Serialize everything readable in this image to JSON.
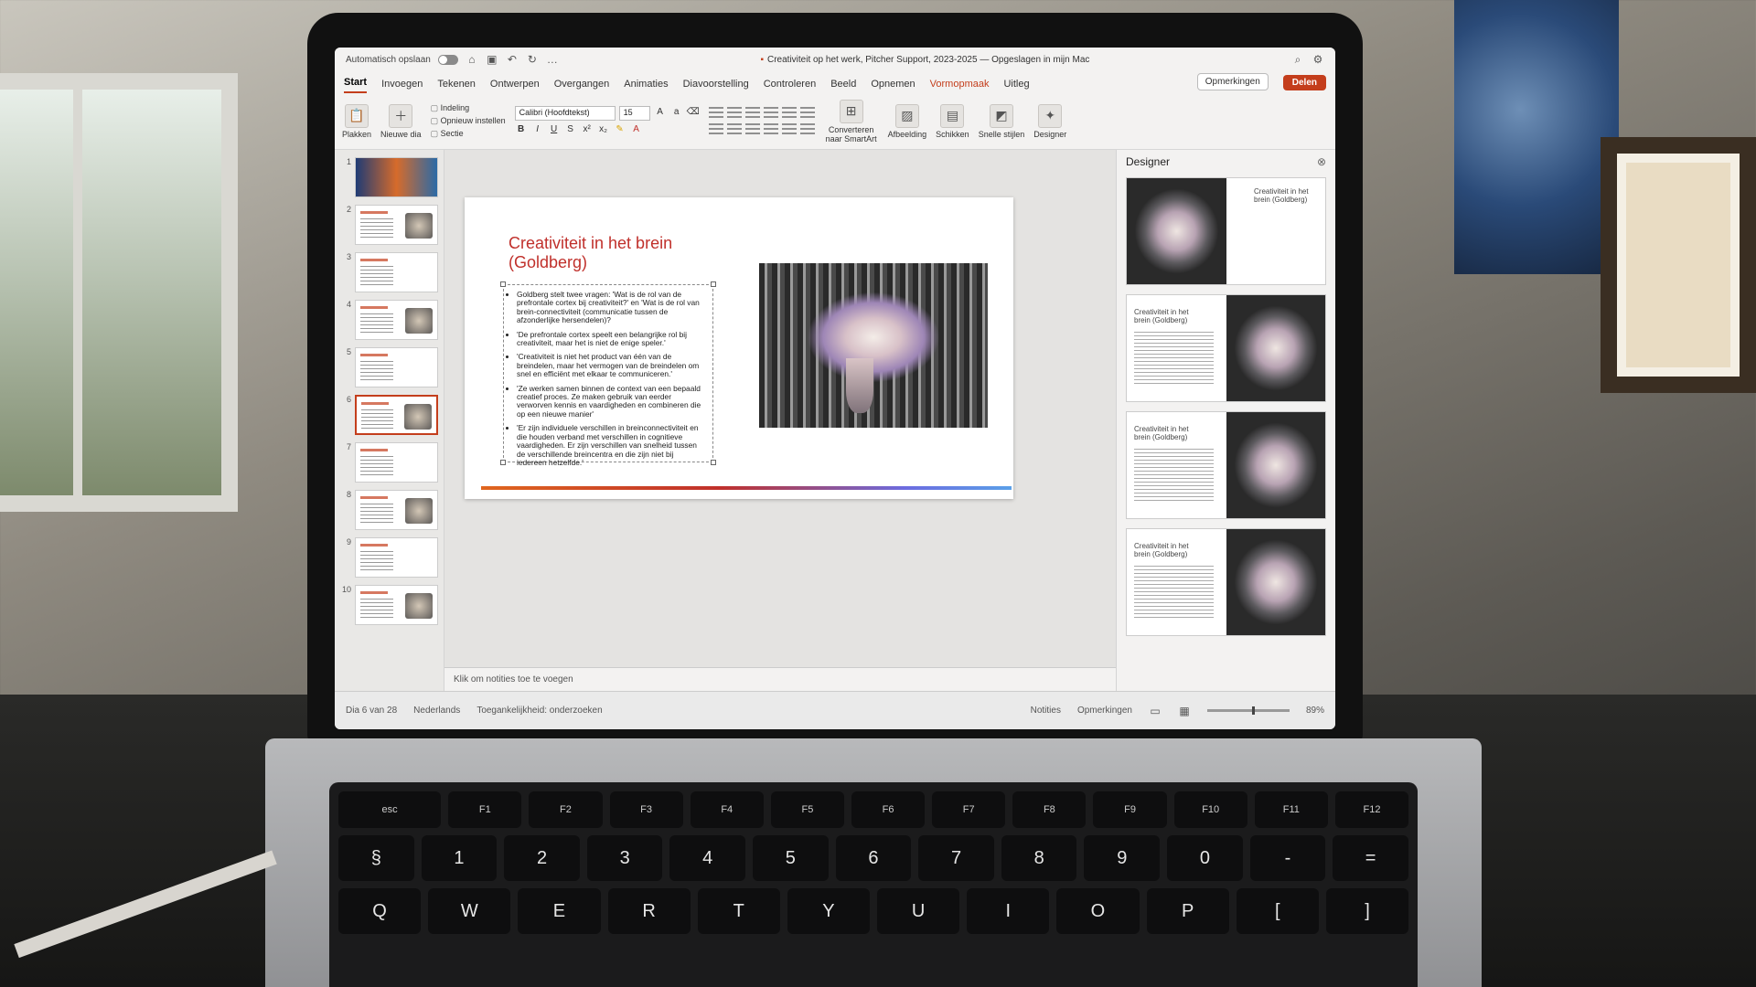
{
  "window": {
    "autosave": "Automatisch opslaan",
    "doc_title": "Creativiteit op het werk, Pitcher Support, 2023-2025 — Opgeslagen in mijn Mac"
  },
  "tabs": [
    "Start",
    "Invoegen",
    "Tekenen",
    "Ontwerpen",
    "Overgangen",
    "Animaties",
    "Diavoorstelling",
    "Controleren",
    "Beeld",
    "Opnemen",
    "Vormopmaak"
  ],
  "tab_active": "Start",
  "tab_contextual": "Vormopmaak",
  "uitleg": "Uitleg",
  "comments_label": "Opmerkingen",
  "share_label": "Delen",
  "accent": "#c43e1c",
  "ribbon": {
    "paste": "Plakken",
    "new_slide": "Nieuwe dia",
    "layout": "Indeling",
    "reset": "Opnieuw instellen",
    "section": "Sectie",
    "font_name": "Calibri (Hoofdtekst)",
    "font_size": "15",
    "convert_smartart": "Converteren naar SmartArt",
    "picture": "Afbeelding",
    "arrange": "Schikken",
    "quick_styles": "Snelle stijlen",
    "designer": "Designer"
  },
  "thumbnails": [
    "1",
    "2",
    "3",
    "4",
    "5",
    "6",
    "7",
    "8",
    "9",
    "10"
  ],
  "selected_slide": 6,
  "slide": {
    "title": "Creativiteit in het brein (Goldberg)",
    "bullets": [
      "Goldberg stelt twee vragen: 'Wat is de rol van de prefrontale cortex bij creativiteit?' en 'Wat is de rol van brein-connectiviteit (communicatie tussen de afzonderlijke hersendelen)?",
      "'De prefrontale cortex speelt een belangrijke rol bij creativiteit, maar het is niet de enige speler.'",
      "'Creativiteit is niet het product van één van de breindelen, maar het vermogen van de breindelen om snel en efficiënt met elkaar te communiceren.'",
      "'Ze werken samen binnen de context van een bepaald creatief proces. Ze maken gebruik van eerder verworven kennis en vaardigheden en combineren die op een nieuwe manier'",
      "'Er zijn individuele verschillen in breinconnectiviteit en die houden verband met verschillen in cognitieve vaardigheden. Er zijn verschillen van snelheid tussen de verschillende breincentra en die zijn niet bij iedereen hetzelfde.'"
    ]
  },
  "notes_placeholder": "Klik om notities toe te voegen",
  "designer": {
    "title": "Designer",
    "options": [
      "Creativiteit in het brein (Goldberg)",
      "Creativiteit in het brein (Goldberg)",
      "Creativiteit in het brein (Goldberg)",
      "Creativiteit in het brein (Goldberg)"
    ]
  },
  "status": {
    "slide_of": "Dia 6 van 28",
    "language": "Nederlands",
    "accessibility": "Toegankelijkheid: onderzoeken",
    "notes": "Notities",
    "comments": "Opmerkingen",
    "zoom": "89%"
  },
  "keyboard": {
    "fn_row": [
      "esc",
      "F1",
      "F2",
      "F3",
      "F4",
      "F5",
      "F6",
      "F7",
      "F8",
      "F9",
      "F10",
      "F11",
      "F12"
    ],
    "num_row": [
      "§",
      "1",
      "2",
      "3",
      "4",
      "5",
      "6",
      "7",
      "8",
      "9",
      "0",
      "-",
      "="
    ],
    "q_row": [
      "Q",
      "W",
      "E",
      "R",
      "T",
      "Y",
      "U",
      "I",
      "O",
      "P",
      "[",
      "]"
    ]
  }
}
